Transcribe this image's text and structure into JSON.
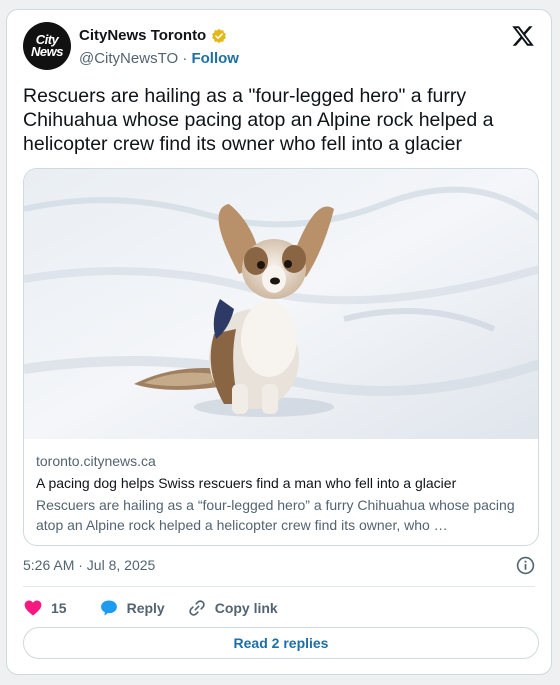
{
  "account": {
    "avatar_text_line1": "City",
    "avatar_text_line2": "News",
    "display_name": "CityNews Toronto",
    "handle": "@CityNewsTO",
    "separator": "·",
    "follow_label": "Follow",
    "verified_badge_color": "#e2b719"
  },
  "tweet": {
    "text": "Rescuers are hailing as a \"four-legged hero\" a furry Chihuahua whose pacing atop an Alpine rock helped a helicopter crew find its owner who fell into a glacier"
  },
  "link_card": {
    "image_icon": "dog-in-snow-photo",
    "domain": "toronto.citynews.ca",
    "title": "A pacing dog helps Swiss rescuers find a man who fell into a glacier",
    "description": "Rescuers are hailing as a “four-legged hero” a furry Chihuahua whose pacing atop an Alpine rock helped a helicopter crew find its owner, who …"
  },
  "meta": {
    "timestamp": "5:26 AM · Jul 8, 2025"
  },
  "actions": {
    "like_count": "15",
    "reply_label": "Reply",
    "copy_link_label": "Copy link"
  },
  "footer": {
    "read_replies_label": "Read 2 replies"
  },
  "colors": {
    "like_pink": "#f91880",
    "link_blue": "#1d6fa5",
    "reply_bubble": "#1d9bf0"
  }
}
